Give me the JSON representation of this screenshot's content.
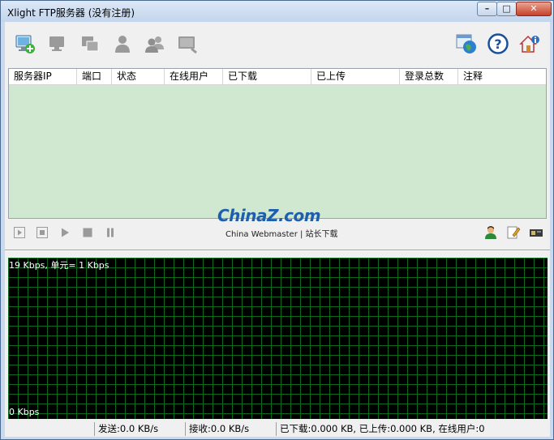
{
  "window": {
    "title": "Xlight FTP服务器 (没有注册)"
  },
  "window_controls": {
    "minimize": "–",
    "maximize": "□",
    "close": "✕"
  },
  "toolbar": {
    "left_icons": [
      "add-server-icon",
      "server-icon",
      "server-settings-icon",
      "user-icon",
      "users-icon",
      "monitor-icon"
    ],
    "right_icons": [
      "web-globe-icon",
      "help-icon",
      "about-icon"
    ]
  },
  "table": {
    "columns": [
      "服务器IP",
      "端口",
      "状态",
      "在线用户",
      "已下载",
      "已上传",
      "登录总数",
      "注释"
    ],
    "rows": []
  },
  "watermark": {
    "logo": "ChinaZ.com",
    "subtitle": "China Webmaster | 站长下载"
  },
  "controls": {
    "left": [
      "start-all-icon",
      "stop-all-icon",
      "start-icon",
      "stop-icon",
      "pause-icon"
    ],
    "right": [
      "user-manage-icon",
      "edit-icon",
      "card-icon"
    ]
  },
  "graph": {
    "top_label": "19 Kbps, 单元= 1 Kbps",
    "bottom_label": "0 Kbps"
  },
  "statusbar": {
    "send": "发送:0.0 KB/s",
    "recv": "接收:0.0 KB/s",
    "totals": "已下载:0.000 KB, 已上传:0.000 KB, 在线用户:0"
  },
  "colors": {
    "grid_bg": "#d0e8d0",
    "graph_bg": "#000000",
    "graph_grid": "#0c6a1e"
  }
}
